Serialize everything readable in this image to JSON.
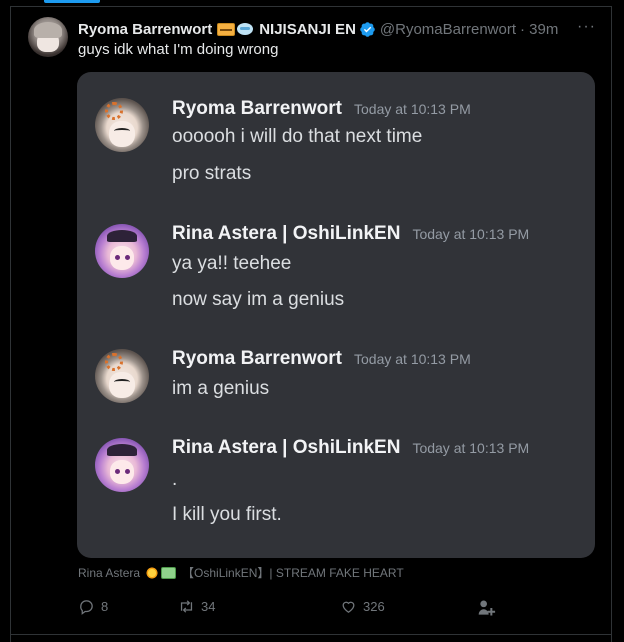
{
  "tweet": {
    "author_name": "Ryoma Barrenwort",
    "author_emojis": [
      "credit-card-emoji",
      "wind-face-emoji"
    ],
    "affiliation": "NIJISANJI EN",
    "verified": true,
    "handle": "@RyomaBarrenwort",
    "time": "· 39m",
    "more_label": "···",
    "text": "guys idk what I'm doing wrong"
  },
  "chat": {
    "messages": [
      {
        "author": "Ryoma Barrenwort",
        "time": "Today at 10:13 PM",
        "lines": [
          "oooooh i will do that next time",
          "pro strats"
        ]
      },
      {
        "author": "Rina Astera | OshiLinkEN",
        "time": "Today at 10:13 PM",
        "lines": [
          "ya ya!! teehee",
          "now say im a genius"
        ]
      },
      {
        "author": "Ryoma Barrenwort",
        "time": "Today at 10:13 PM",
        "lines": [
          "im a genius"
        ]
      },
      {
        "author": "Rina Astera | OshiLinkEN",
        "time": "Today at 10:13 PM",
        "lines": [
          ".",
          "I kill you first."
        ]
      }
    ]
  },
  "attribution": {
    "name": "Rina Astera",
    "emojis": [
      "sun-emoji",
      "money-emoji"
    ],
    "rest": "【OshiLinkEN】| STREAM FAKE HEART"
  },
  "actions": {
    "replies": "8",
    "retweets": "34",
    "likes": "326"
  },
  "colors": {
    "background": "#000000",
    "accent": "#1d9bf0",
    "discord_bg": "#313338",
    "muted": "#71767b"
  }
}
